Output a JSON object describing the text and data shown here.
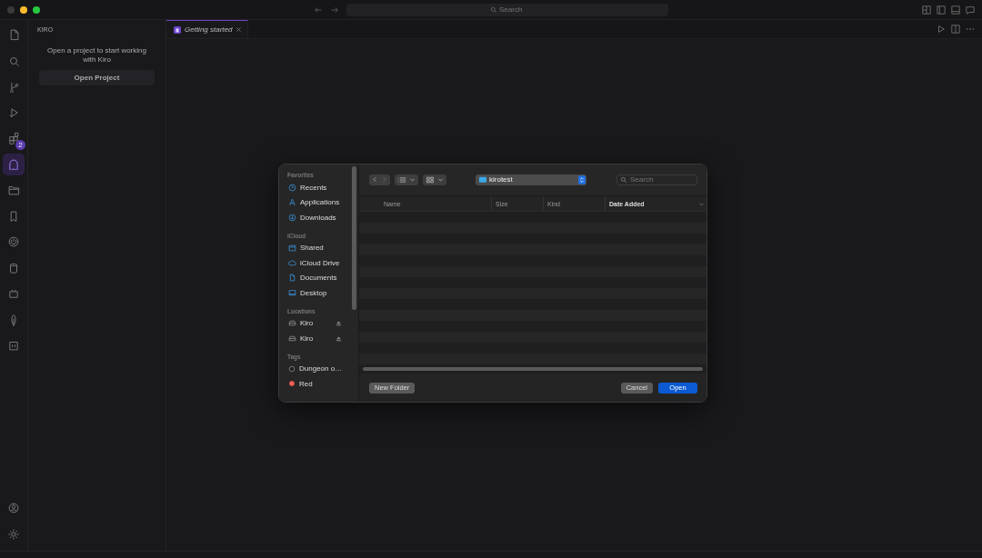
{
  "titlebar": {
    "search": {
      "placeholder": "Search"
    }
  },
  "activity_bar": {
    "items": [
      {
        "kind": "files",
        "selected": false
      },
      {
        "kind": "search",
        "selected": false
      },
      {
        "kind": "branch",
        "selected": false
      },
      {
        "kind": "run",
        "selected": false
      },
      {
        "kind": "extensions",
        "selected": false,
        "badge": "2"
      },
      {
        "kind": "ghost",
        "selected": true
      },
      {
        "kind": "folder",
        "selected": false
      },
      {
        "kind": "bookmark",
        "selected": false
      },
      {
        "kind": "power",
        "selected": false
      },
      {
        "kind": "database",
        "selected": false
      },
      {
        "kind": "robot",
        "selected": false
      },
      {
        "kind": "leaf",
        "selected": false
      },
      {
        "kind": "bot",
        "selected": false
      }
    ],
    "bottom": [
      {
        "kind": "account"
      },
      {
        "kind": "settings"
      }
    ]
  },
  "sidebar": {
    "title": "KIRO",
    "message": "Open a project to start working with Kiro",
    "button": "Open Project"
  },
  "tabs": [
    {
      "label": "Getting started",
      "selected": true
    }
  ],
  "dialog": {
    "sidebar": [
      {
        "heading": "Favorites",
        "items": [
          {
            "label": "Recents",
            "kind": "clock"
          },
          {
            "label": "Applications",
            "kind": "apps"
          },
          {
            "label": "Downloads",
            "kind": "download"
          }
        ]
      },
      {
        "heading": "iCloud",
        "items": [
          {
            "label": "Shared",
            "kind": "shared"
          },
          {
            "label": "iCloud Drive",
            "kind": "cloud"
          },
          {
            "label": "Documents",
            "kind": "doc"
          },
          {
            "label": "Desktop",
            "kind": "desktop"
          }
        ]
      },
      {
        "heading": "Locations",
        "items": [
          {
            "label": "Kiro",
            "kind": "disk",
            "eject": true
          },
          {
            "label": "Kiro",
            "kind": "disk",
            "eject": true
          }
        ]
      },
      {
        "heading": "Tags",
        "items": [
          {
            "label": "Dungeon o…",
            "kind": "tag",
            "color": "#1e1e1e"
          },
          {
            "label": "Red",
            "kind": "tag",
            "color": "#ff5f57"
          }
        ]
      }
    ],
    "location": "kirotest",
    "search": {
      "placeholder": "Search"
    },
    "columns": [
      {
        "label": "Name",
        "sorted": false
      },
      {
        "label": "Size",
        "sorted": false
      },
      {
        "label": "Kind",
        "sorted": false
      },
      {
        "label": "Date Added",
        "sorted": true
      }
    ],
    "buttons": {
      "new_folder": "New Folder",
      "cancel": "Cancel",
      "open": "Open"
    }
  }
}
